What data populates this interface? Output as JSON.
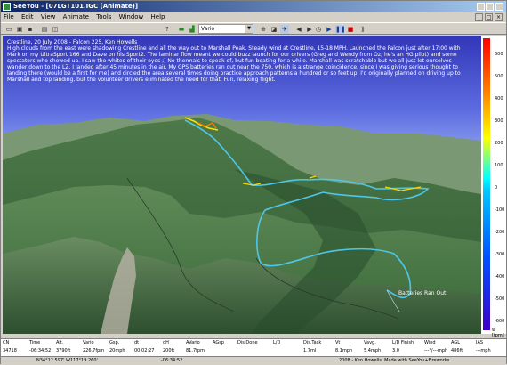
{
  "window": {
    "title": "SeeYou - [07LGT101.IGC (Animate)]"
  },
  "menu": [
    "File",
    "Edit",
    "View",
    "Animate",
    "Tools",
    "Window",
    "Help"
  ],
  "toolbar": {
    "vario_select": "Vario"
  },
  "flight_text": {
    "line1": "Crestline, 20 July 2008 - Falcon 225, Ken Howells",
    "body": "High clouds from the east were shadowing Crestline and all the way out to Marshall Peak.  Steady wind at Crestline, 15-18 MPH. Launched the Falcon just after 17:00 with Mark on my UltraSport 166 and Dave on his Sport2.  The laminar flow meant we could buzz launch for our drivers (Greg and Wendy from Oz; he's an HG pilot) and some spectators who showed up.  I saw the whites of their eyes ;)  No thermals to speak of, but fun boating for a while. Marshall was scratchable but we all just let ourselves wander down to the LZ.  I landed after 45 minutes in the air.  My GPS batteries ran out near the 750, which is a strange coincidence, since I was giving serious thought to landing there (would be a first for me) and circled the area several times doing practice approach patterns a hundred or so feet up.  I'd originally planned on driving up to Marshall and top landing, but the volunteer drivers eliminated the need for that.  Fun, relaxing flight."
  },
  "annotation": "Batteries Ran Out",
  "scale": {
    "unit": "w [fpm]",
    "ticks": [
      "600",
      "500",
      "400",
      "300",
      "200",
      "100",
      "0",
      "-100",
      "-200",
      "-300",
      "-400",
      "-500",
      "-600"
    ]
  },
  "table": {
    "headers": [
      "CN",
      "Time",
      "Alt.",
      "Vario",
      "Gsp.",
      "dt",
      "dH",
      "AVario",
      "AGsp",
      "Dis.Done",
      "L/D",
      "Dis.Task",
      "Vt",
      "Vavg.",
      "L/D Finish",
      "Wind",
      "AGL",
      "IAS"
    ],
    "values": [
      "34718",
      "-06:34:52",
      "3790ft",
      "226.7fpm",
      "20mph",
      "00:02:27",
      "200ft",
      "81.7fpm",
      "",
      "",
      "",
      "1.7ml",
      "8.1mph",
      "5.4mph",
      "3.0",
      "---°/---mph",
      "486ft",
      "---mph"
    ]
  },
  "status": {
    "coords": "N34°12.597' W117°19.260'",
    "time": "-06:34:52",
    "credit": "2008 - Ken Howells. Made with SeeYou+Fireworks"
  }
}
